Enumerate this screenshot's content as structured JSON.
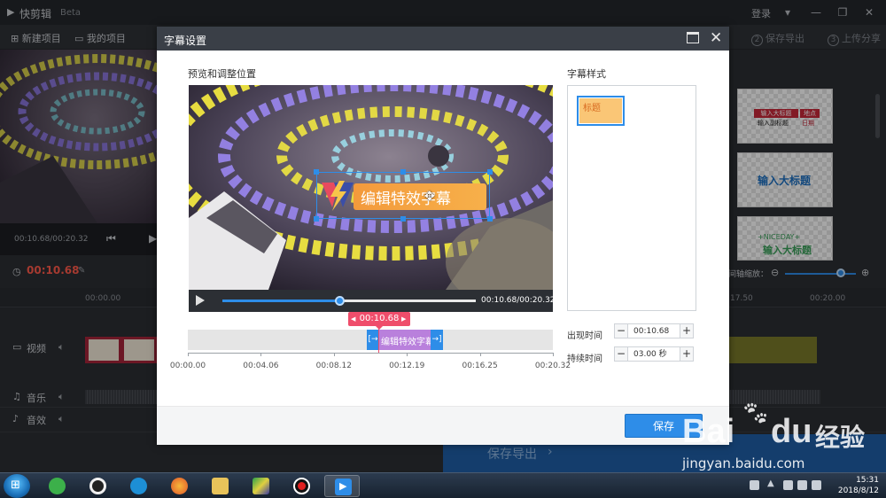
{
  "app": {
    "name": "快剪辑",
    "badge": "Beta",
    "login": "登录",
    "toolbar": {
      "new_project": "新建项目",
      "my_projects": "我的项目",
      "step2_num": "2",
      "step2": "保存导出",
      "step3_num": "3",
      "step3": "上传分享"
    },
    "preview_time": "00:10.68/00:20.32",
    "current_time": "00:10.68",
    "ruler_labels": [
      "00:00.00",
      "17.50",
      "00:20.00"
    ],
    "zoom_label": "间轴缩放：",
    "tracks": {
      "video": "视频",
      "music": "音乐",
      "sfx": "音效"
    },
    "export_button": "保存导出"
  },
  "templates": [
    {
      "line1": "输入大标题",
      "line1_tag": "地点",
      "line2": "输入副标题",
      "line2_tag": "日期"
    },
    {
      "title": "输入大标题"
    },
    {
      "caption": "+NICEDAY+",
      "title": "输入大标题"
    }
  ],
  "dialog": {
    "title": "字幕设置",
    "preview_label": "预览和调整位置",
    "caption_text": "编辑特效字幕",
    "video_time": "00:10.68/00:20.32",
    "progress": 0.46,
    "timeline_tag": "00:10.68",
    "clip_text": "编辑特效字幕",
    "ticks": [
      "00:00.00",
      "00:04.06",
      "00:08.12",
      "00:12.19",
      "00:16.25",
      "00:20.32"
    ],
    "style_label": "字幕样式",
    "style_chip": "标题",
    "appear_label": "出现时间",
    "appear_value": "00:10.68",
    "duration_label": "持续时间",
    "duration_value": "03.00 秒",
    "minus": "−",
    "plus": "+",
    "save": "保存"
  },
  "watermark": {
    "brand": "Bai",
    "brand2": "du",
    "cn": "经验",
    "url": "jingyan.baidu.com"
  },
  "taskbar": {
    "time": "15:31",
    "date": "2018/8/12"
  }
}
